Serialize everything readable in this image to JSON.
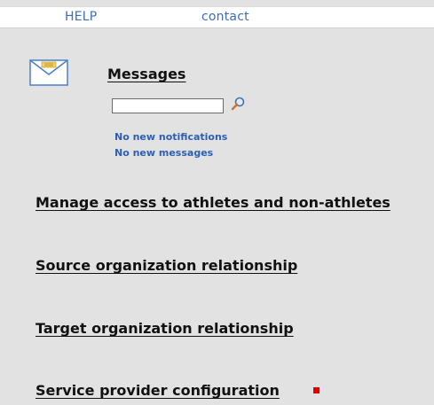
{
  "nav": {
    "help_label": "HELP",
    "contact_label": "contact"
  },
  "messages": {
    "title": "Messages",
    "search_value": "",
    "notifications_text": "No new notifications",
    "messages_text": "No new messages"
  },
  "links": {
    "manage_access": "Manage access to athletes and non-athletes",
    "source_org": "Source organization relationship",
    "target_org": "Target organization relationship",
    "service_provider": "Service provider configuration"
  },
  "icons": {
    "envelope": "envelope-icon",
    "search": "magnifier-icon",
    "marker": "red-square-marker"
  },
  "colors": {
    "link_blue": "#3a6fb8",
    "notice_blue": "#2d5fb0",
    "marker_red": "#e00000",
    "background": "#e2e2e2"
  }
}
